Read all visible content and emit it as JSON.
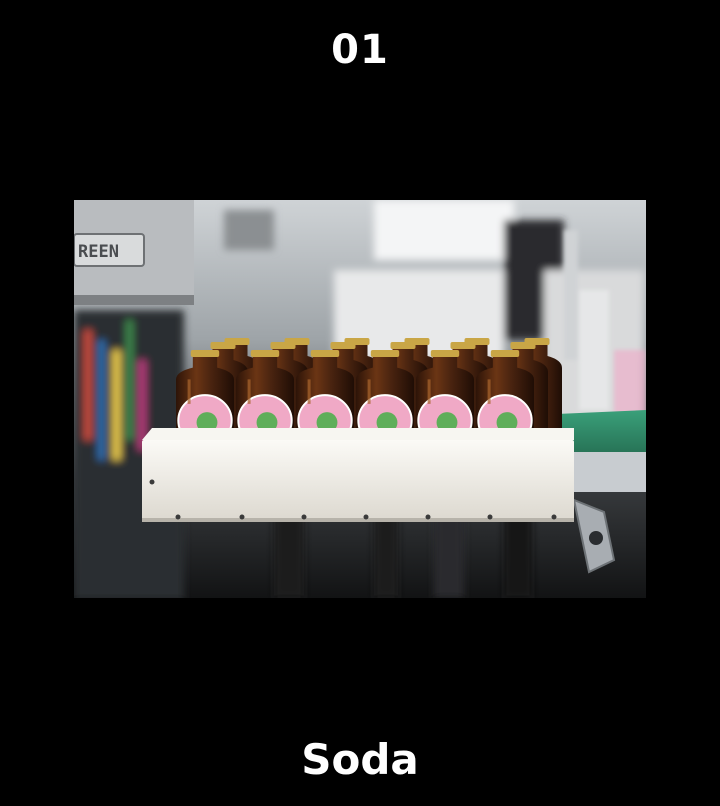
{
  "number": "01",
  "title": "Soda",
  "photo": {
    "sign_text": "REEN",
    "bottle_count": 6,
    "colors": {
      "bottle": "#4a2410",
      "cap": "#c9a646",
      "label_pink": "#f0a9c6",
      "label_green": "#5fae5a",
      "tray": "#f2f0ea",
      "belt": "#2f8a6a"
    }
  }
}
